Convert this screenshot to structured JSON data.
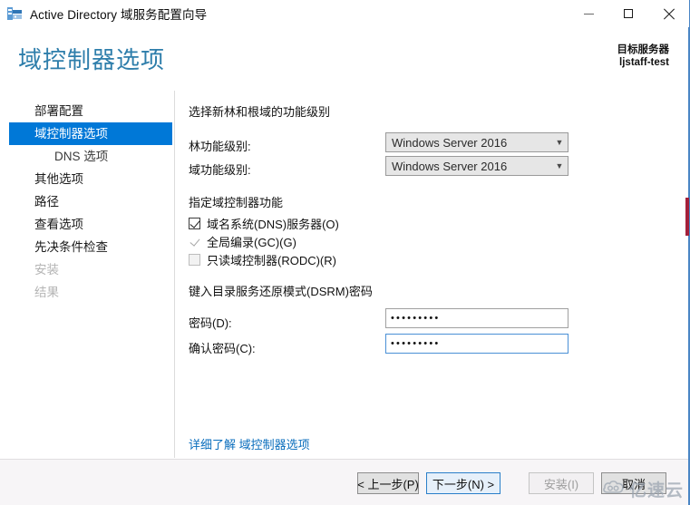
{
  "window": {
    "title": "Active Directory 域服务配置向导",
    "icon": "server-manager-icon",
    "controls": {
      "minimize": "minimize-icon",
      "maximize": "maximize-icon",
      "close": "close-icon"
    }
  },
  "header": {
    "page_title": "域控制器选项",
    "target_server_label": "目标服务器",
    "target_server_name": "ljstaff-test"
  },
  "sidebar": {
    "items": [
      {
        "label": "部署配置",
        "state": "normal",
        "indent": false
      },
      {
        "label": "域控制器选项",
        "state": "selected",
        "indent": false
      },
      {
        "label": "DNS 选项",
        "state": "normal",
        "indent": true
      },
      {
        "label": "其他选项",
        "state": "normal",
        "indent": false
      },
      {
        "label": "路径",
        "state": "normal",
        "indent": false
      },
      {
        "label": "查看选项",
        "state": "normal",
        "indent": false
      },
      {
        "label": "先决条件检查",
        "state": "normal",
        "indent": false
      },
      {
        "label": "安装",
        "state": "disabled",
        "indent": false
      },
      {
        "label": "结果",
        "state": "disabled",
        "indent": false
      }
    ]
  },
  "main": {
    "functional_level_heading": "选择新林和根域的功能级别",
    "forest_level": {
      "label": "林功能级别:",
      "value": "Windows Server 2016",
      "chevron": "chevron-down-icon"
    },
    "domain_level": {
      "label": "域功能级别:",
      "value": "Windows Server 2016",
      "chevron": "chevron-down-icon"
    },
    "capabilities_heading": "指定域控制器功能",
    "capabilities": [
      {
        "label": "域名系统(DNS)服务器(O)",
        "accel": "O",
        "checked": true,
        "enabled": true
      },
      {
        "label": "全局编录(GC)(G)",
        "accel": "G",
        "checked": true,
        "enabled": false
      },
      {
        "label": "只读域控制器(RODC)(R)",
        "accel": "R",
        "checked": false,
        "enabled": false
      }
    ],
    "dsrm_heading": "键入目录服务还原模式(DSRM)密码",
    "password": {
      "label": "密码(D):",
      "value": "•••••••••",
      "focused": false
    },
    "confirm_password": {
      "label": "确认密码(C):",
      "value": "•••••••••",
      "focused": true
    },
    "more_link": "详细了解 域控制器选项"
  },
  "footer": {
    "back": "< 上一步(P)",
    "next": "下一步(N) >",
    "install": "安装(I)",
    "cancel": "取消"
  },
  "watermark": {
    "text": "亿速云",
    "logo": "cloud-icon"
  },
  "colors": {
    "accent_blue": "#0078d7",
    "title_blue": "#2e7eab",
    "link_blue": "#0a6ebd",
    "footer_bg": "#f7f5f7",
    "combo_bg": "#e6e6e6"
  }
}
